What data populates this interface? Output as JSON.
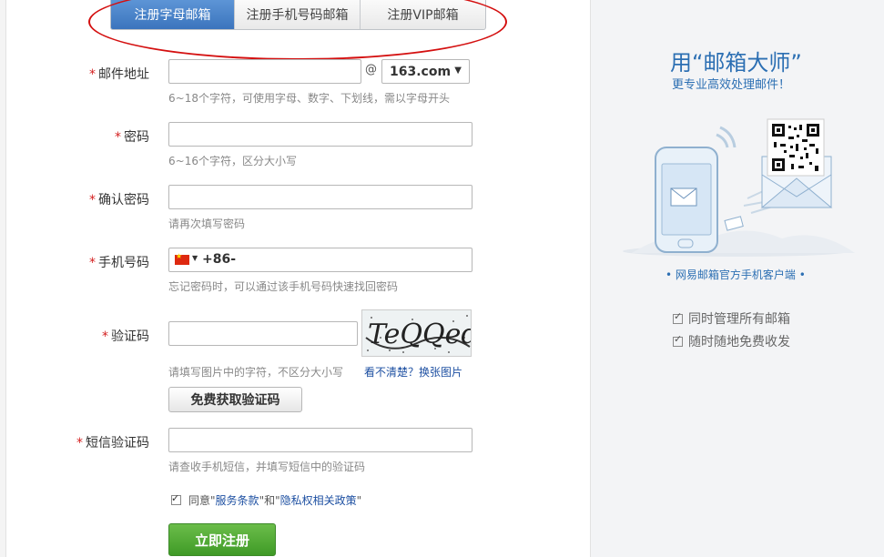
{
  "tabs": [
    {
      "label": "注册字母邮箱",
      "active": true
    },
    {
      "label": "注册手机号码邮箱",
      "active": false
    },
    {
      "label": "注册VIP邮箱",
      "active": false
    }
  ],
  "form": {
    "email": {
      "label": "邮件地址",
      "value": "",
      "hint": "6~18个字符，可使用字母、数字、下划线，需以字母开头",
      "at": "@",
      "domain": "163.com"
    },
    "password": {
      "label": "密码",
      "value": "",
      "hint": "6~16个字符，区分大小写"
    },
    "confirm": {
      "label": "确认密码",
      "value": "",
      "hint": "请再次填写密码"
    },
    "phone": {
      "label": "手机号码",
      "dial_code": "+86-",
      "value": "",
      "hint": "忘记密码时，可以通过该手机号码快速找回密码"
    },
    "captcha": {
      "label": "验证码",
      "value": "",
      "hint": "请填写图片中的字符，不区分大小写",
      "image_text": "TeQQed",
      "refresh_link": "看不清楚？换张图片",
      "get_code_button": "免费获取验证码"
    },
    "sms": {
      "label": "短信验证码",
      "value": "",
      "hint": "请查收手机短信，并填写短信中的验证码"
    },
    "required_mark": "*",
    "agreement": {
      "prefix": "同意",
      "q1": "\"",
      "terms_link": "服务条款",
      "mid": "\"和\"",
      "privacy_link": "隐私权相关政策",
      "q2": "\"",
      "checked": true
    },
    "submit_label": "立即注册"
  },
  "sidebar": {
    "promo_title": "用“邮箱大师”",
    "promo_subtitle": "更专业高效处理邮件！",
    "client_label": "• 网易邮箱官方手机客户端 •",
    "features": [
      "同时管理所有邮箱",
      "随时随地免费收发"
    ]
  },
  "colors": {
    "accent_blue": "#2c6fb3",
    "link_blue": "#1e50a2",
    "submit_green": "#4fa83a",
    "required_red": "#d42020",
    "annotation_red": "#d41010"
  }
}
